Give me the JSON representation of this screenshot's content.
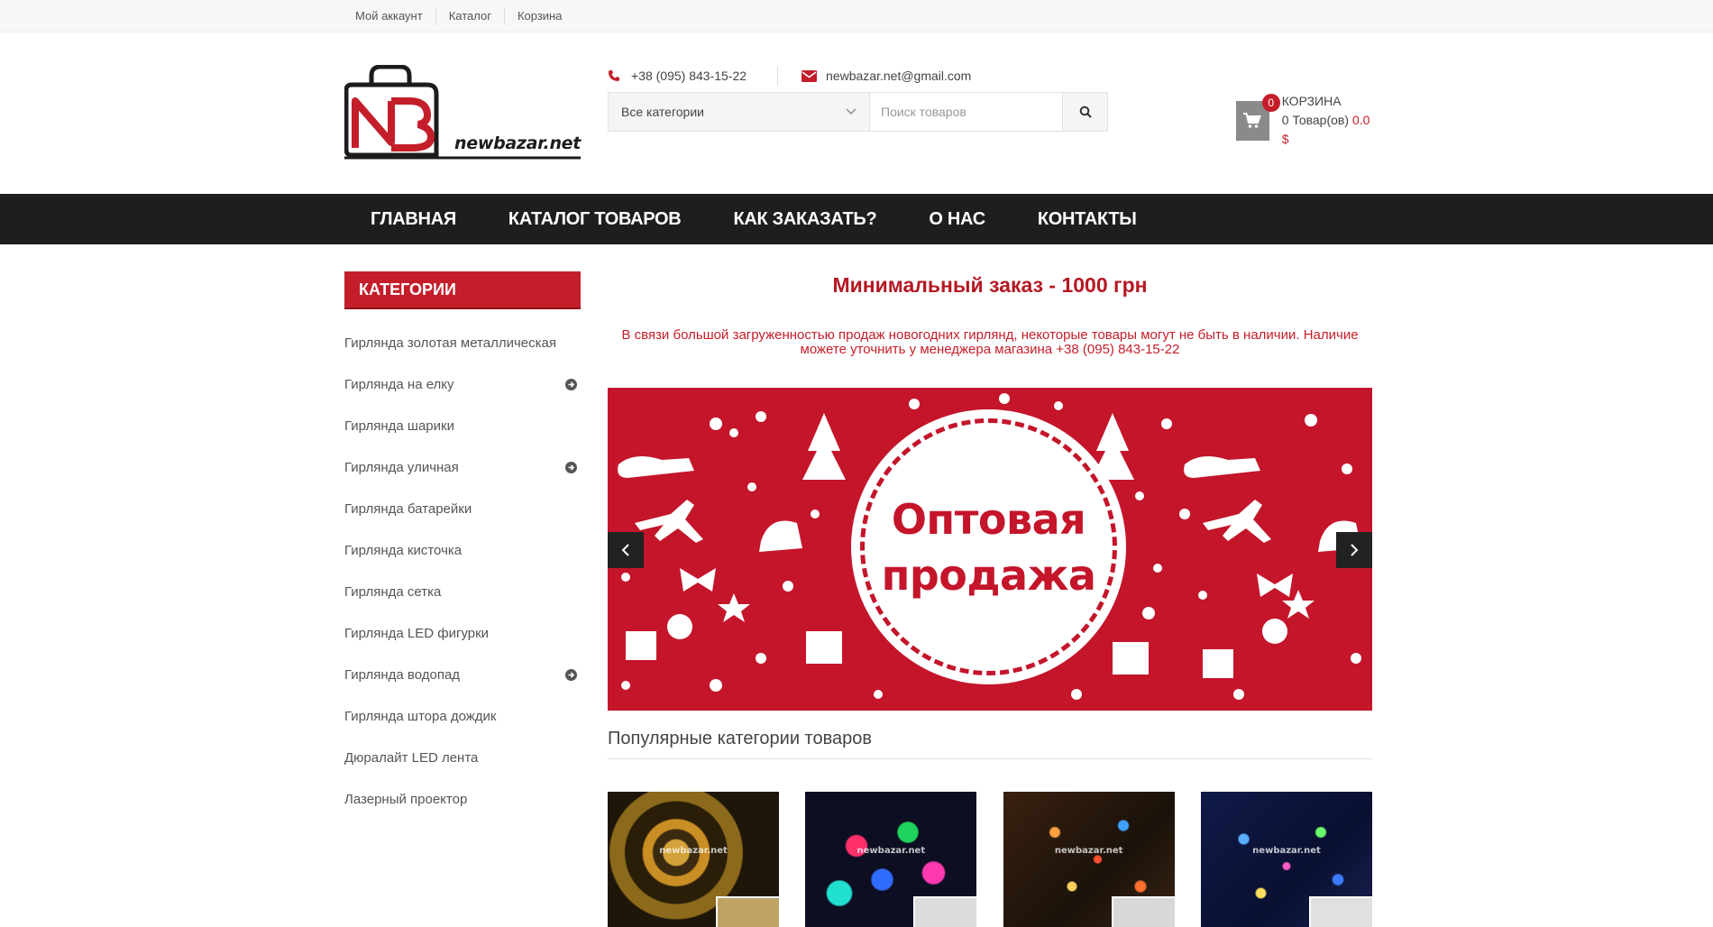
{
  "top_links": [
    "Мой аккаунт",
    "Каталог",
    "Корзина"
  ],
  "logo": {
    "text": "newbazar.net"
  },
  "contacts": {
    "phone": "+38 (095) 843-15-22",
    "email": "newbazar.net@gmail.com"
  },
  "search": {
    "category": "Все категории",
    "placeholder": "Поиск товаров"
  },
  "cart": {
    "count": "0",
    "title": "КОРЗИНА",
    "items": "0 Товар(ов)",
    "total": "0.0 $"
  },
  "nav": [
    "ГЛАВНАЯ",
    "КАТАЛОГ ТОВАРОВ",
    "КАК ЗАКАЗАТЬ?",
    "О НАС",
    "КОНТАКТЫ"
  ],
  "sidebar": {
    "title": "КАТЕГОРИИ",
    "items": [
      {
        "label": "Гирлянда золотая металлическая",
        "has_sub": false
      },
      {
        "label": "Гирлянда на елку",
        "has_sub": true
      },
      {
        "label": "Гирлянда шарики",
        "has_sub": false
      },
      {
        "label": "Гирлянда уличная",
        "has_sub": true
      },
      {
        "label": "Гирлянда батарейки",
        "has_sub": false
      },
      {
        "label": "Гирлянда кисточка",
        "has_sub": false
      },
      {
        "label": "Гирлянда сетка",
        "has_sub": false
      },
      {
        "label": "Гирлянда LED фигурки",
        "has_sub": false
      },
      {
        "label": "Гирлянда водопад",
        "has_sub": true
      },
      {
        "label": "Гирлянда штора дождик",
        "has_sub": false
      },
      {
        "label": "Дюралайт LED лента",
        "has_sub": false
      },
      {
        "label": "Лазерный проектор",
        "has_sub": false
      }
    ]
  },
  "main": {
    "min_order": "Минимальный заказ - 1000 грн",
    "notice": "В связи большой загруженностью продаж новогодних гирлянд, некоторые товары могут не быть в наличии. Наличие можете уточнить у менеджера магазина +38 (095) 843-15-22",
    "banner": {
      "line1": "Оптовая",
      "line2": "продажа"
    },
    "popular_title": "Популярные категории товаров",
    "watermark": "newbazar.net"
  },
  "colors": {
    "brand_red": "#c41e2a",
    "nav_bg": "#1e1e1e",
    "banner_red": "#c4152a"
  }
}
